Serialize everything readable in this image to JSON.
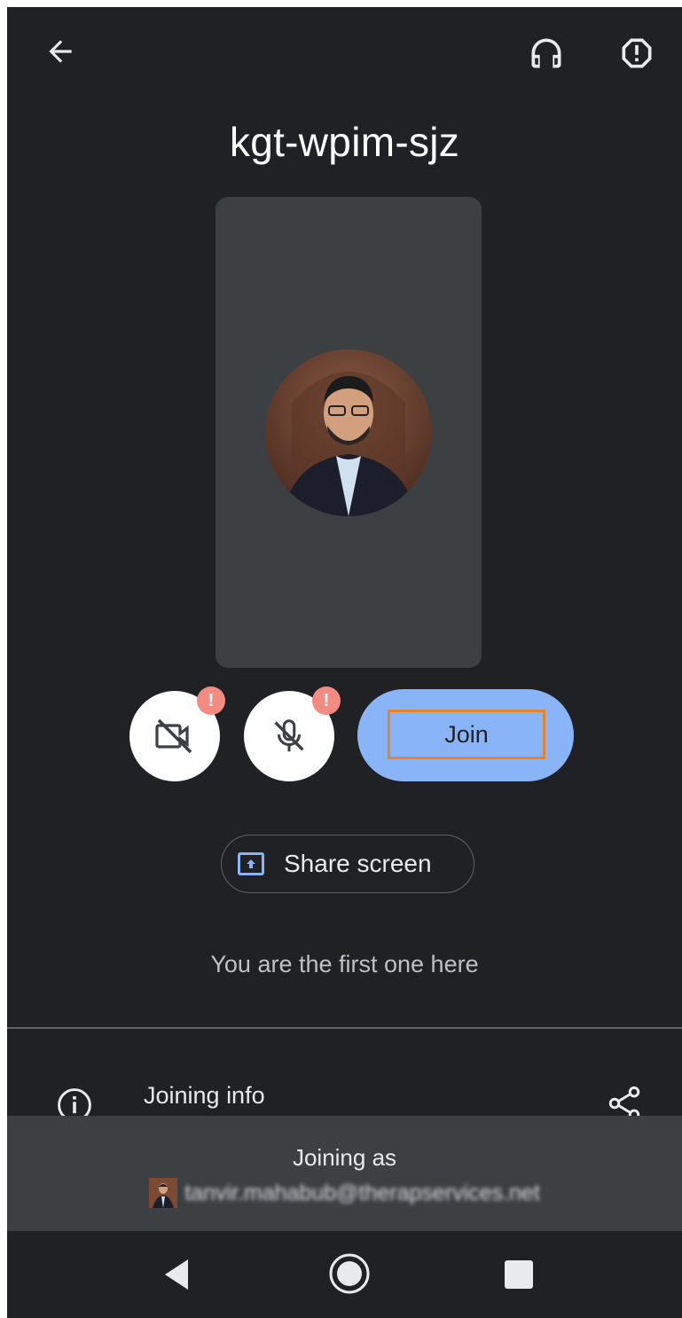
{
  "header": {
    "back_icon": "arrow-back-icon",
    "audio_icon": "headphones-icon",
    "report_icon": "report-icon"
  },
  "meeting": {
    "code": "kgt-wpim-sjz"
  },
  "controls": {
    "camera_icon": "videocam-off-icon",
    "mic_icon": "mic-off-icon",
    "camera_badge": "!",
    "mic_badge": "!",
    "join_label": "Join",
    "share_label": "Share screen",
    "share_icon": "screen-share-icon"
  },
  "status_text": "You are the first one here",
  "joining_info": {
    "label": "Joining info",
    "info_icon": "info-icon",
    "share_icon": "share-icon"
  },
  "account": {
    "joining_as_label": "Joining as",
    "email": "tanvir.mahabub@therapservices.net"
  },
  "nav": {
    "back": "nav-back-icon",
    "home": "nav-home-icon",
    "recents": "nav-recents-icon"
  },
  "colors": {
    "background": "#202124",
    "preview": "#3c4043",
    "join_button": "#8ab4f8",
    "badge": "#f28b82",
    "highlight": "#e8832a"
  }
}
